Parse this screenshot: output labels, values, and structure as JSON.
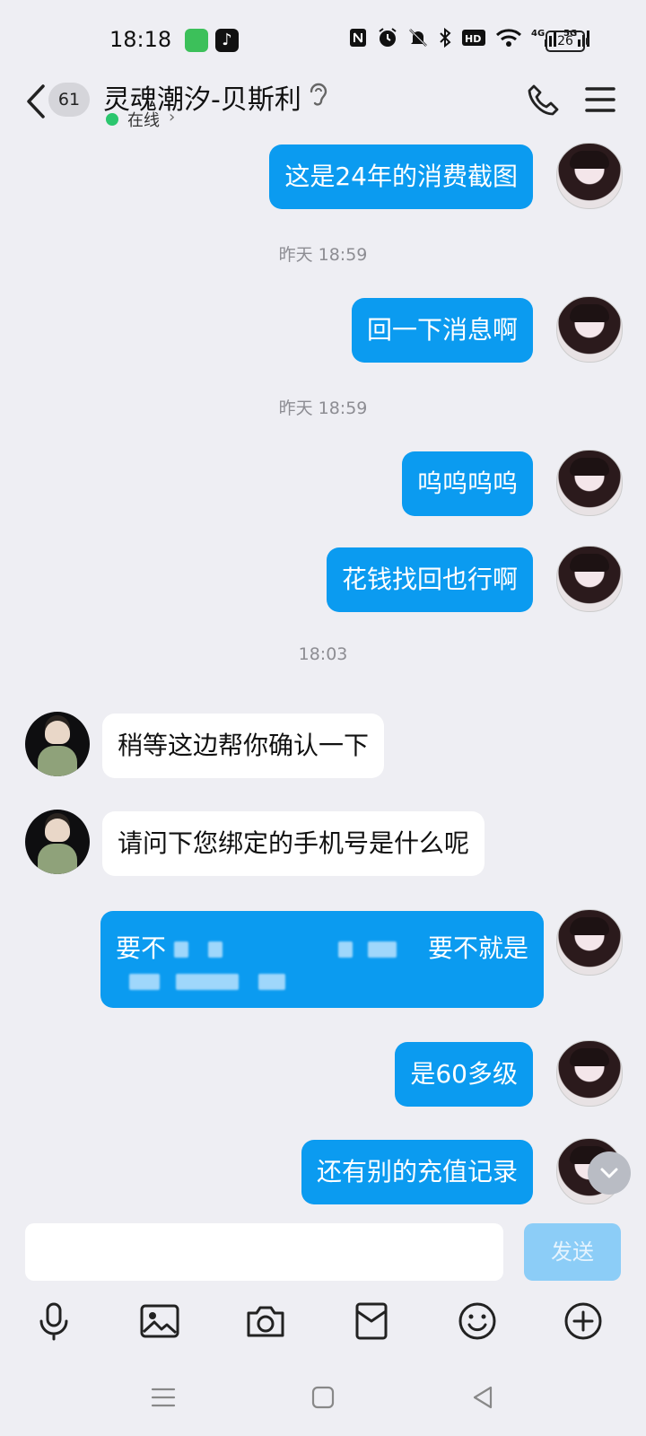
{
  "status_bar": {
    "time": "18:18",
    "network": "4G 5G",
    "battery": "26",
    "icons": [
      "messages-app-icon",
      "tiktok-icon",
      "nfc-icon",
      "alarm-icon",
      "mute-icon",
      "bluetooth-icon",
      "hd-icon",
      "wifi-icon",
      "signal-icon",
      "battery-icon"
    ]
  },
  "header": {
    "unread_badge": "61",
    "contact_name": "灵魂潮汐-贝斯利",
    "status": "在线",
    "status_color": "#2bc66e"
  },
  "messages": [
    {
      "side": "me",
      "text": "这是24年的消费截图"
    },
    {
      "type": "timestamp",
      "text": "昨天 18:59"
    },
    {
      "side": "me",
      "text": "回一下消息啊"
    },
    {
      "type": "timestamp",
      "text": "昨天 18:59"
    },
    {
      "side": "me",
      "text": "呜呜呜呜"
    },
    {
      "side": "me",
      "text": "花钱找回也行啊"
    },
    {
      "type": "timestamp",
      "text": "18:03"
    },
    {
      "side": "other",
      "text": "稍等这边帮你确认一下"
    },
    {
      "side": "other",
      "text": "请问下您绑定的手机号是什么呢"
    },
    {
      "side": "me",
      "text_start": "要不",
      "text_end": "要不就是",
      "redacted": true
    },
    {
      "side": "me",
      "text": "是60多级"
    },
    {
      "side": "me",
      "text": "还有别的充值记录"
    }
  ],
  "input": {
    "value": "",
    "send_label": "发送"
  },
  "toolbar": [
    "microphone-icon",
    "image-icon",
    "camera-icon",
    "red-packet-icon",
    "emoji-icon",
    "plus-icon"
  ],
  "colors": {
    "bubble_me": "#0b9bf0",
    "bubble_other": "#ffffff",
    "background": "#eeeef3",
    "send_disabled": "#8ccdf7"
  }
}
